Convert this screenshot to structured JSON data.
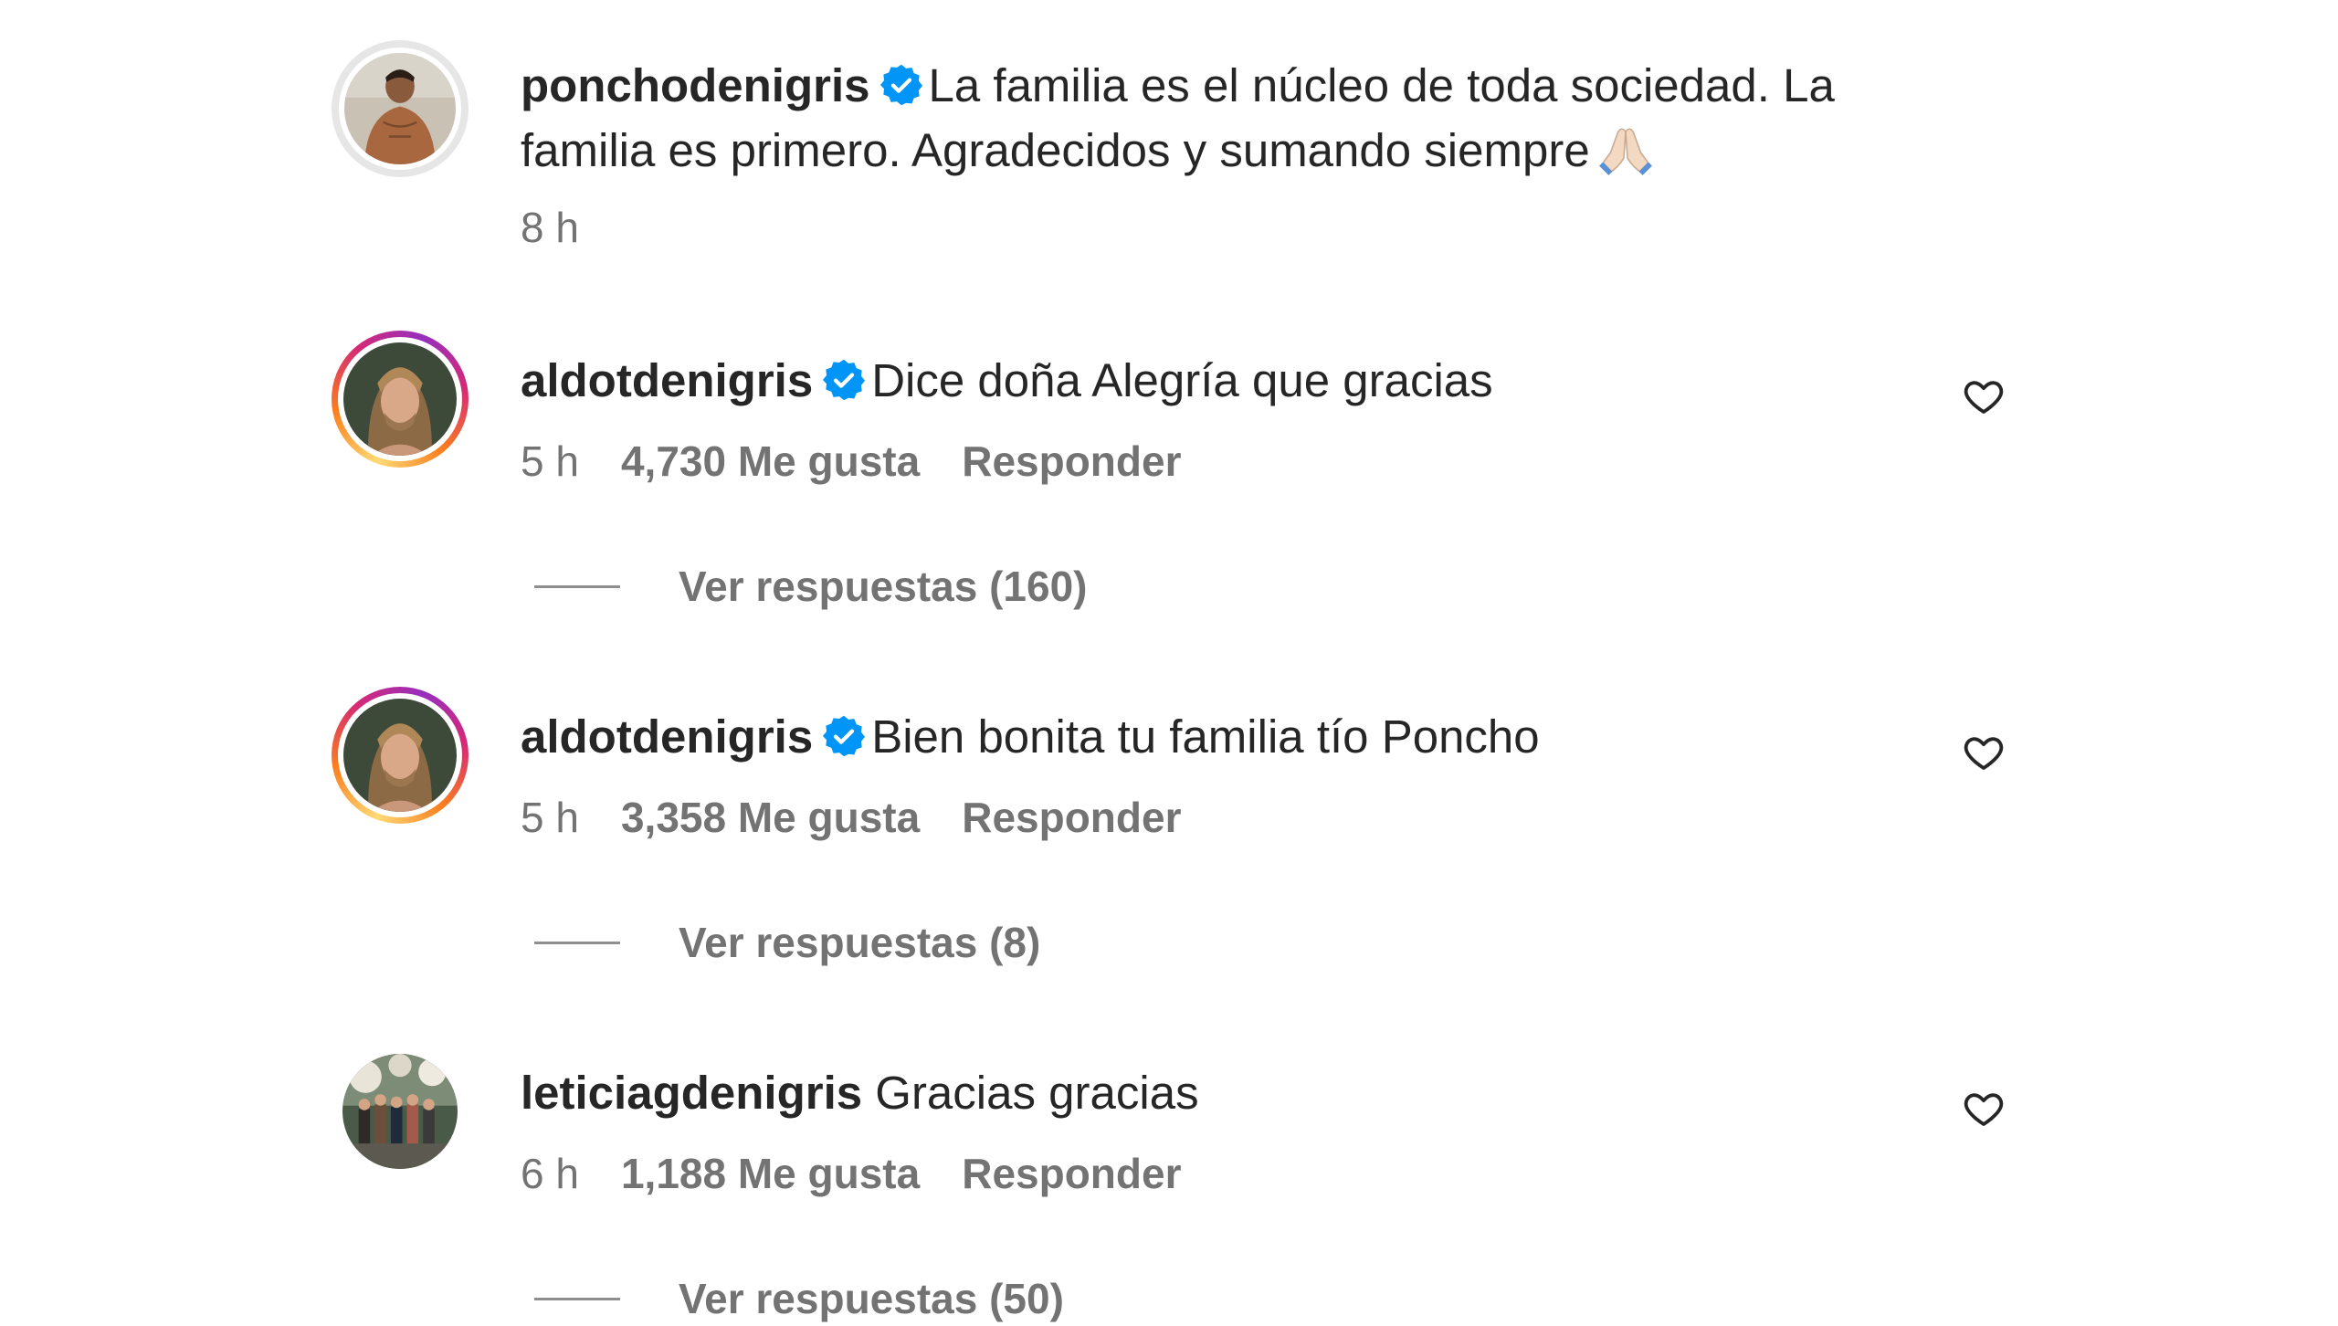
{
  "caption": {
    "username": "ponchodenigris",
    "verified": true,
    "text_line1": "La familia es el núcleo de toda sociedad. La",
    "text_line2": "familia es primero. Agradecidos y sumando siempre",
    "emoji": "folded-hands-emoji",
    "time": "8 h"
  },
  "comments": [
    {
      "username": "aldotdenigris",
      "verified": true,
      "text": "Dice doña Alegría que gracias",
      "time": "5 h",
      "likes": "4,730 Me gusta",
      "reply_label": "Responder",
      "view_replies": "Ver respuestas (160)"
    },
    {
      "username": "aldotdenigris",
      "verified": true,
      "text": "Bien bonita tu familia tío Poncho",
      "time": "5 h",
      "likes": "3,358 Me gusta",
      "reply_label": "Responder",
      "view_replies": "Ver respuestas (8)"
    },
    {
      "username": "leticiagdenigris",
      "verified": false,
      "text": "Gracias gracias",
      "time": "6 h",
      "likes": "1,188 Me gusta",
      "reply_label": "Responder",
      "view_replies": "Ver respuestas (50)"
    }
  ],
  "icons": {
    "verified": "verified-badge-icon",
    "like": "heart-icon"
  },
  "colors": {
    "verified_blue": "#0095f6",
    "text_primary": "#262626",
    "text_secondary": "#737373"
  }
}
